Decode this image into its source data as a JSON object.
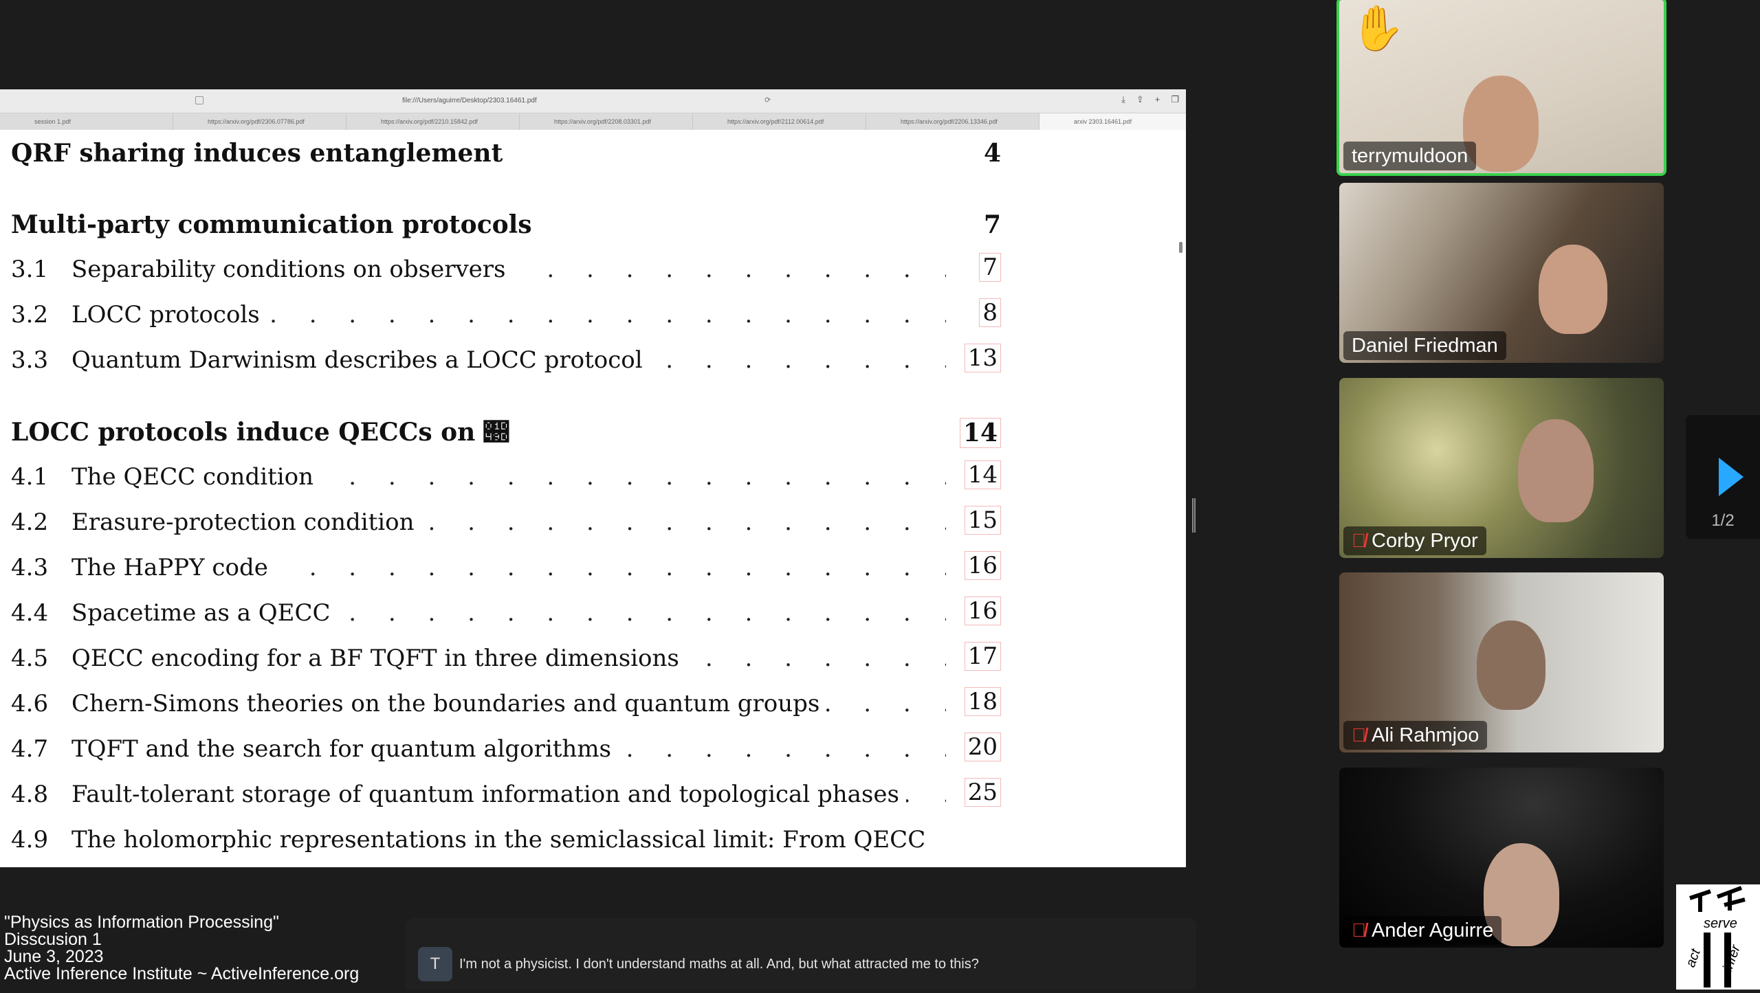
{
  "browser": {
    "url": "file:///Users/aguirre/Desktop/2303.16461.pdf",
    "tabs": [
      "session 1.pdf",
      "https://arxiv.org/pdf/2306.07786.pdf",
      "https://arxiv.org/pdf/2210.15842.pdf",
      "https://arxiv.org/pdf/2208.03301.pdf",
      "https://arxiv.org/pdf/2112.00614.pdf",
      "https://arxiv.org/pdf/2206.13346.pdf",
      "arxiv 2303.16461.pdf"
    ]
  },
  "toc": {
    "sec2": {
      "title": "QRF sharing induces entanglement",
      "page": "4"
    },
    "sec3": {
      "title": "Multi-party communication protocols",
      "page": "7"
    },
    "sec3_items": [
      {
        "num": "3.1",
        "title": "Separability conditions on observers",
        "page": "7"
      },
      {
        "num": "3.2",
        "title": "LOCC protocols",
        "page": "8"
      },
      {
        "num": "3.3",
        "title": "Quantum Darwinism describes a LOCC protocol",
        "page": "13"
      }
    ],
    "sec4": {
      "title": "LOCC protocols induce QECCs on 𝒝",
      "page": "14"
    },
    "sec4_items": [
      {
        "num": "4.1",
        "title": "The QECC condition",
        "page": "14"
      },
      {
        "num": "4.2",
        "title": "Erasure-protection condition",
        "page": "15"
      },
      {
        "num": "4.3",
        "title": "The HaPPY code",
        "page": "16"
      },
      {
        "num": "4.4",
        "title": "Spacetime as a QECC",
        "page": "16"
      },
      {
        "num": "4.5",
        "title": "QECC encoding for a BF TQFT in three dimensions",
        "page": "17"
      },
      {
        "num": "4.6",
        "title": "Chern-Simons theories on the boundaries and quantum groups",
        "page": "18"
      },
      {
        "num": "4.7",
        "title": "TQFT and the search for quantum algorithms",
        "page": "20"
      },
      {
        "num": "4.8",
        "title": "Fault-tolerant storage of quantum information and topological phases",
        "page": "25"
      },
      {
        "num": "4.9",
        "title": "The holomorphic representations in the semiclassical limit:  From QECC",
        "page": ""
      }
    ]
  },
  "participants": [
    {
      "name": "terrymuldoon",
      "muted": false,
      "hand_raised": true,
      "hand_icon": "raised-hand-icon"
    },
    {
      "name": "Daniel Friedman",
      "muted": false
    },
    {
      "name": "Corby Pryor",
      "muted": true
    },
    {
      "name": "Ali Rahmjoo",
      "muted": true
    },
    {
      "name": "Ander Aguirre",
      "muted": true
    }
  ],
  "pager": {
    "count": "1/2"
  },
  "info": {
    "line1": "\"Physics as Information Processing\"",
    "line2": "Disscusion 1",
    "line3": "June 3, 2023",
    "line4": "Active Inference Institute ~ ActiveInference.org"
  },
  "caption": {
    "avatar_initial": "T",
    "text": "I'm not a physicist. I don't understand maths at all. And, but what attracted me to this?"
  },
  "logo": {
    "serve": "serve",
    "act": "act",
    "infer": "infer"
  },
  "colors": {
    "active_speaker": "#3ad14e",
    "pager_arrow": "#29a8ff",
    "muted": "#e53935"
  }
}
